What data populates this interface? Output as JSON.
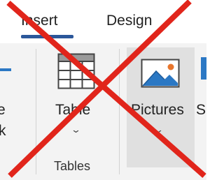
{
  "tabs": [
    {
      "label": "Insert",
      "selected": true
    },
    {
      "label": "Design",
      "selected": false
    }
  ],
  "left_partial": {
    "line1": "e",
    "line2": "k"
  },
  "commands": {
    "table": {
      "label": "Table",
      "icon": "table-grid-icon"
    },
    "pictures": {
      "label": "Pictures",
      "icon": "picture-icon"
    },
    "next_partial": "S"
  },
  "groups": {
    "tables": "Tables"
  },
  "overlay": {
    "icon": "red-x-cross-icon"
  },
  "colors": {
    "accent": "#2b579a",
    "cross": "#e1251b",
    "ribbon": "#f3f3f3",
    "picture_sun": "#e8762d",
    "picture_blue": "#2b78c4"
  }
}
